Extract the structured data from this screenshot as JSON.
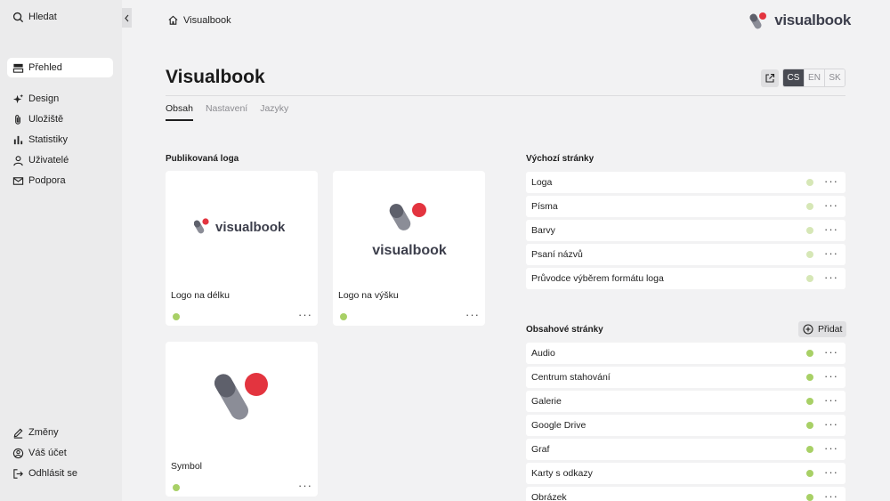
{
  "sidebar": {
    "top": [
      {
        "label": "Hledat",
        "icon": "search-icon"
      }
    ],
    "overview": {
      "label": "Přehled",
      "icon": "layout-icon"
    },
    "items": [
      {
        "label": "Design",
        "icon": "sparkle-icon"
      },
      {
        "label": "Uložiště",
        "icon": "paperclip-icon"
      },
      {
        "label": "Statistiky",
        "icon": "bar-chart-icon"
      },
      {
        "label": "Uživatelé",
        "icon": "user-icon"
      },
      {
        "label": "Podpora",
        "icon": "mail-icon"
      }
    ],
    "bottom": [
      {
        "label": "Změny",
        "icon": "pen-icon"
      },
      {
        "label": "Váš účet",
        "icon": "account-icon"
      },
      {
        "label": "Odhlásit se",
        "icon": "logout-icon"
      }
    ]
  },
  "breadcrumb": {
    "label": "Visualbook",
    "icon": "home-icon"
  },
  "brand": {
    "name": "visualbook",
    "accent": "#e3343f",
    "dark": "#3d3f4c"
  },
  "page": {
    "title": "Visualbook",
    "tabs": [
      {
        "label": "Obsah",
        "active": true
      },
      {
        "label": "Nastavení",
        "active": false
      },
      {
        "label": "Jazyky",
        "active": false
      }
    ],
    "languages": [
      {
        "code": "CS",
        "active": true
      },
      {
        "code": "EN",
        "active": false
      },
      {
        "code": "SK",
        "active": false
      }
    ]
  },
  "published_logos": {
    "title": "Publikovaná loga",
    "cards": [
      {
        "label": "Logo na délku",
        "status": "published"
      },
      {
        "label": "Logo na výšku",
        "status": "published"
      },
      {
        "label": "Symbol",
        "status": "published"
      }
    ],
    "logo_text": "visualbook"
  },
  "default_pages": {
    "title": "Výchozí stránky",
    "items": [
      "Loga",
      "Písma",
      "Barvy",
      "Psaní názvů",
      "Průvodce výběrem formátu loga"
    ],
    "status_color": "#d6e7b6"
  },
  "content_pages": {
    "title": "Obsahové stránky",
    "add_label": "Přidat",
    "items": [
      "Audio",
      "Centrum stahování",
      "Galerie",
      "Google Drive",
      "Graf",
      "Karty s odkazy",
      "Obrázek"
    ],
    "status_color": "#a8d066"
  },
  "more_label": "···"
}
